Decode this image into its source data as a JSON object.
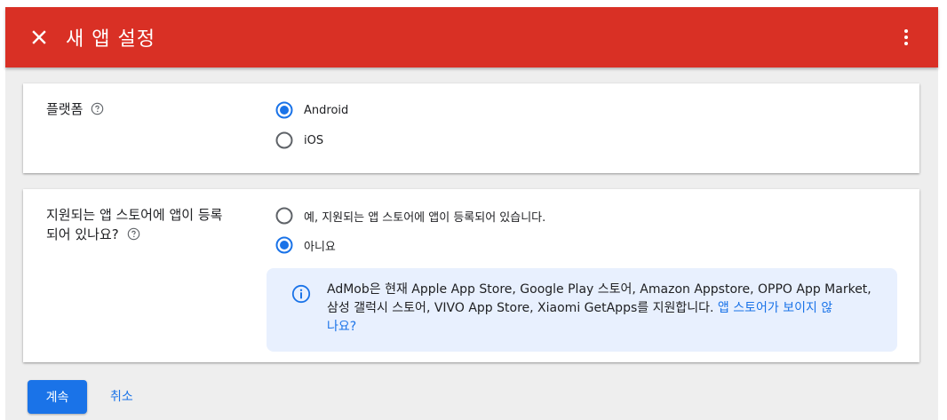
{
  "header": {
    "title": "새 앱 설정",
    "close_icon": "close-icon",
    "more_icon": "more-vert-icon",
    "color": "#d93025"
  },
  "platform": {
    "label": "플랫폼",
    "options": [
      {
        "label": "Android",
        "selected": true
      },
      {
        "label": "iOS",
        "selected": false
      }
    ]
  },
  "store": {
    "label_line1": "지원되는 앱 스토어에 앱이 등록",
    "label_line2": "되어 있나요?",
    "options": [
      {
        "label": "예, 지원되는 앱 스토어에 앱이 등록되어 있습니다.",
        "selected": false
      },
      {
        "label": "아니요",
        "selected": true
      }
    ],
    "info": {
      "line1": "AdMob은 현재 Apple App Store, Google Play 스토어, Amazon Appstore, OPPO App Market,",
      "line2": "삼성 갤럭시 스토어, VIVO App Store, Xiaomi GetApps를 지원합니다. ",
      "link_part1": "앱 스토어가 보이지 않",
      "link_part2": "나요?"
    }
  },
  "actions": {
    "continue_label": "계속",
    "cancel_label": "취소"
  },
  "colors": {
    "accent": "#1a73e8",
    "info_bg": "#e8f0fe"
  }
}
